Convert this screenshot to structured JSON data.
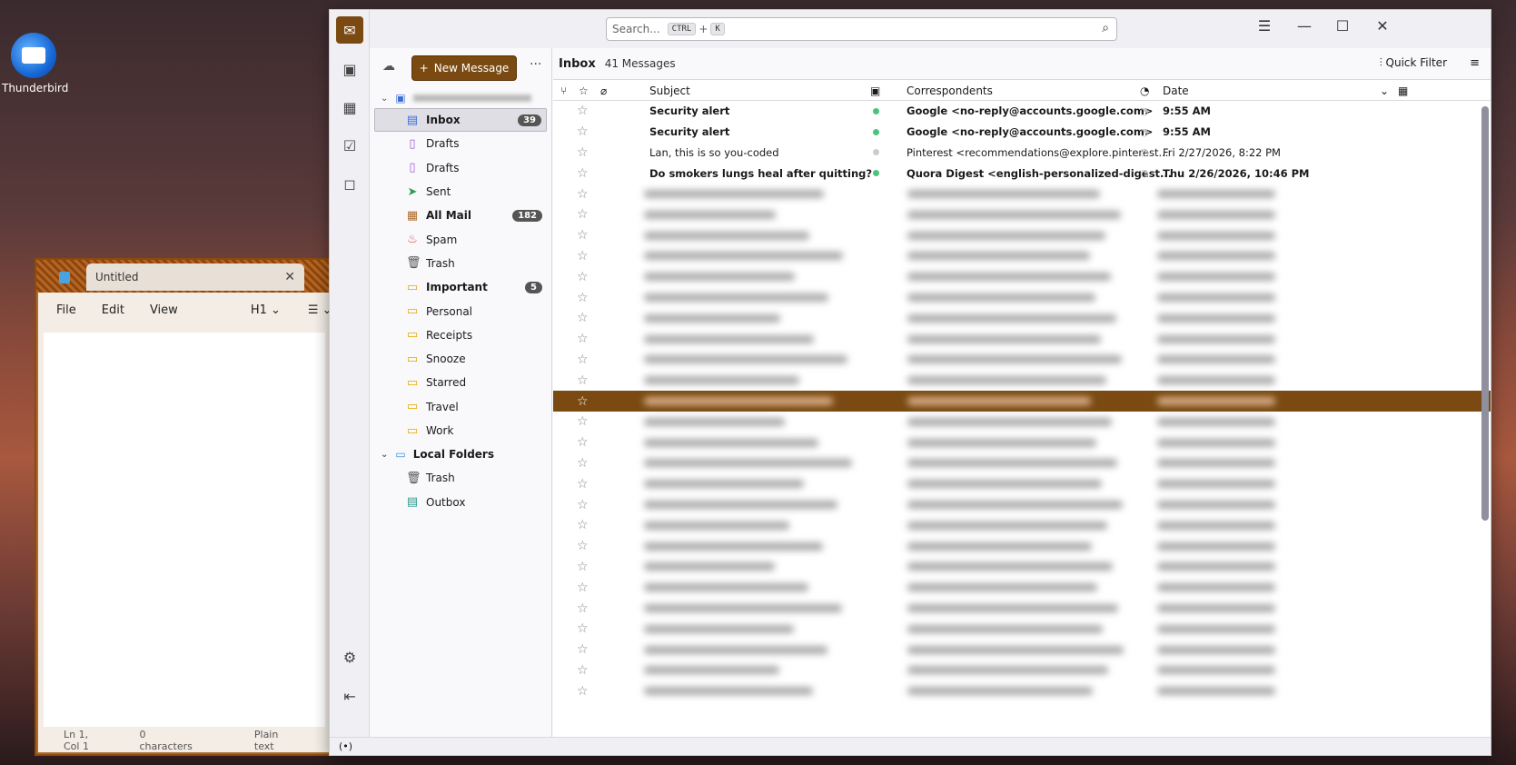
{
  "desktop": {
    "icon_label": "Thunderbird"
  },
  "notepad": {
    "tab_title": "Untitled",
    "menu": [
      "File",
      "Edit",
      "View"
    ],
    "heading": "H1",
    "status": {
      "position": "Ln 1, Col 1",
      "chars": "0 characters",
      "format": "Plain text"
    }
  },
  "tb": {
    "search_placeholder": "Search...",
    "search_kbd1": "CTRL",
    "search_plus": "+",
    "search_kbd2": "K",
    "new_message": "New Message",
    "folder_title": "Inbox",
    "message_count": "41 Messages",
    "quick_filter": "Quick Filter",
    "columns": {
      "subject": "Subject",
      "correspondents": "Correspondents",
      "date": "Date"
    },
    "folders": [
      {
        "label": "Inbox",
        "icon": "inbox-icon",
        "glyph": "▤",
        "badge": "39",
        "selected": true,
        "bold": true
      },
      {
        "label": "Drafts",
        "icon": "drafts-icon",
        "glyph": "▯",
        "badge": "",
        "bold": false
      },
      {
        "label": "Drafts",
        "icon": "drafts-icon",
        "glyph": "▯",
        "badge": "",
        "bold": false
      },
      {
        "label": "Sent",
        "icon": "sent-icon",
        "glyph": "➤",
        "badge": "",
        "bold": false
      },
      {
        "label": "All Mail",
        "icon": "archive-icon",
        "glyph": "▦",
        "badge": "182",
        "bold": true
      },
      {
        "label": "Spam",
        "icon": "spam-icon",
        "glyph": "♨",
        "badge": "",
        "bold": false
      },
      {
        "label": "Trash",
        "icon": "trash-icon",
        "glyph": "🗑",
        "badge": "",
        "bold": false
      },
      {
        "label": "Important",
        "icon": "folder-icon",
        "glyph": "▭",
        "badge": "5",
        "bold": true
      },
      {
        "label": "Personal",
        "icon": "folder-icon",
        "glyph": "▭",
        "badge": "",
        "bold": false
      },
      {
        "label": "Receipts",
        "icon": "folder-icon",
        "glyph": "▭",
        "badge": "",
        "bold": false
      },
      {
        "label": "Snooze",
        "icon": "folder-icon",
        "glyph": "▭",
        "badge": "",
        "bold": false
      },
      {
        "label": "Starred",
        "icon": "folder-icon",
        "glyph": "▭",
        "badge": "",
        "bold": false
      },
      {
        "label": "Travel",
        "icon": "folder-icon",
        "glyph": "▭",
        "badge": "",
        "bold": false
      },
      {
        "label": "Work",
        "icon": "folder-icon",
        "glyph": "▭",
        "badge": "",
        "bold": false
      }
    ],
    "local_folders": {
      "label": "Local Folders",
      "items": [
        {
          "label": "Trash",
          "icon": "trash-icon",
          "glyph": "🗑"
        },
        {
          "label": "Outbox",
          "icon": "outbox-icon",
          "glyph": "▤"
        }
      ]
    },
    "messages": [
      {
        "subject": "Security alert",
        "correspondent": "Google <no-reply@accounts.google.com>",
        "date": "9:55 AM",
        "unread": true
      },
      {
        "subject": "Security alert",
        "correspondent": "Google <no-reply@accounts.google.com>",
        "date": "9:55 AM",
        "unread": true
      },
      {
        "subject": "Lan, this is so you-coded",
        "correspondent": "Pinterest <recommendations@explore.pinterest...",
        "date": "Fri 2/27/2026, 8:22 PM",
        "unread": false
      },
      {
        "subject": "Do smokers lungs heal after quitting?",
        "correspondent": "Quora Digest <english-personalized-digest...",
        "date": "Thu 2/26/2026, 10:46 PM",
        "unread": true
      }
    ],
    "colors": {
      "accent": "#7a4a12",
      "unread_dot": "#4cc37a"
    }
  }
}
